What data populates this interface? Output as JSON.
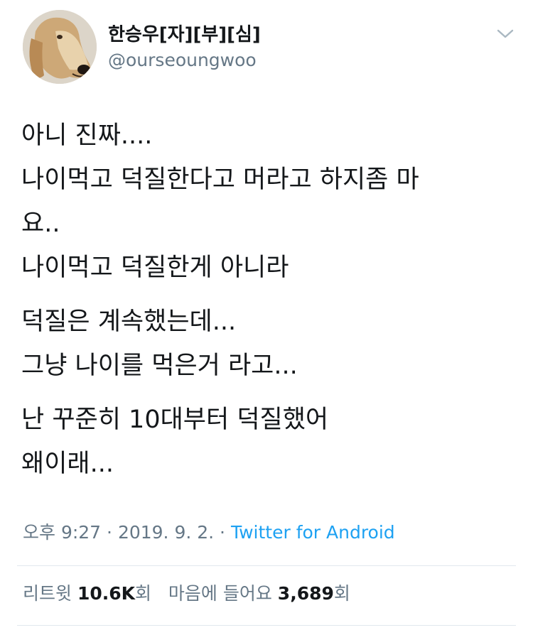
{
  "user": {
    "display_name": "한승우[자][부][심]",
    "handle": "@ourseoungwoo"
  },
  "tweet": {
    "paragraphs": [
      [
        "아니 진짜....",
        "나이먹고 덕질한다고 머라고 하지좀 마",
        "요..",
        "나이먹고 덕질한게 아니라"
      ],
      [
        "덕질은 계속했는데...",
        "그냥 나이를 먹은거 라고..."
      ],
      [
        "난 꾸준히 10대부터 덕질했어",
        "왜이래..."
      ]
    ]
  },
  "meta": {
    "time": "오후 9:27",
    "separator1": " · ",
    "date": "2019. 9. 2.",
    "separator2": " · ",
    "source": "Twitter for Android"
  },
  "stats": {
    "retweets_label": "리트윗",
    "retweets_count": "10.6K",
    "retweets_unit": "회",
    "likes_label": "마음에 들어요",
    "likes_count": "3,689",
    "likes_unit": "회"
  },
  "icons": {
    "caret": "chevron-down-icon",
    "avatar": "afghan-hound-avatar"
  },
  "colors": {
    "text": "#14171a",
    "secondary": "#657786",
    "link": "#1da1f2",
    "divider": "#e1e8ed"
  }
}
